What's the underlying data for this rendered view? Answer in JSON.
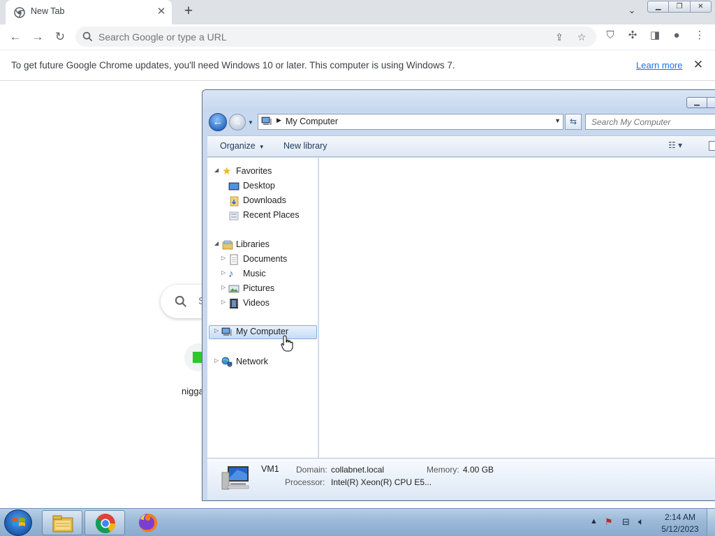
{
  "chrome": {
    "tab_title": "New Tab",
    "omnibox_placeholder": "Search Google or type a URL",
    "infobar_text": "To get future Google Chrome updates, you'll need Windows 10 or later. This computer is using Windows 7.",
    "infobar_link": "Learn more",
    "page_search_partial": "S",
    "shortcut_label": "nigga"
  },
  "explorer": {
    "address_location": "My Computer",
    "search_placeholder": "Search My Computer",
    "command_bar": {
      "organize": "Organize",
      "new_library": "New library"
    },
    "nav_pane": {
      "favorites": "Favorites",
      "favorites_items": [
        "Desktop",
        "Downloads",
        "Recent Places"
      ],
      "libraries": "Libraries",
      "libraries_items": [
        "Documents",
        "Music",
        "Pictures",
        "Videos"
      ],
      "my_computer": "My Computer",
      "network": "Network"
    },
    "details": {
      "computer_name": "VM1",
      "domain_label": "Domain:",
      "domain_value": "collabnet.local",
      "memory_label": "Memory:",
      "memory_value": "4.00 GB",
      "processor_label": "Processor:",
      "processor_value": "Intel(R) Xeon(R) CPU E5..."
    }
  },
  "taskbar": {
    "time": "2:14 AM",
    "date": "5/12/2023"
  },
  "icons": [
    "chrome-icon",
    "close-icon",
    "plus-icon",
    "back-arrow-icon",
    "forward-arrow-icon",
    "reload-icon",
    "search-icon",
    "share-icon",
    "star-icon",
    "shield-icon",
    "puzzle-icon",
    "side-panel-icon",
    "profile-icon",
    "more-icon",
    "folder-star-icon",
    "computer-icon",
    "network-icon",
    "windows-logo-icon",
    "firefox-icon",
    "explorer-icon"
  ]
}
